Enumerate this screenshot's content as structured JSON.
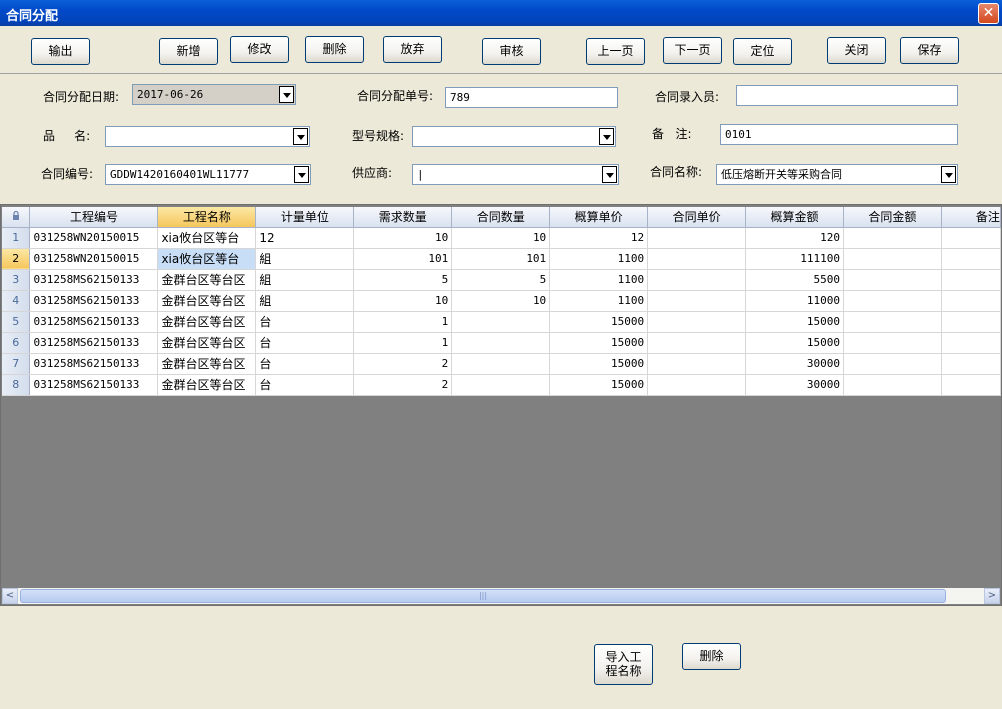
{
  "window": {
    "title": "合同分配",
    "close": "✕"
  },
  "toolbar": {
    "export": "输出",
    "add": "新增",
    "edit": "修改",
    "delete": "删除",
    "discard": "放弃",
    "audit": "审核",
    "prev": "上一页",
    "next": "下一页",
    "locate": "定位",
    "close": "关闭",
    "save": "保存"
  },
  "form": {
    "date_label": "合同分配日期:",
    "date_value": "2017-06-26",
    "no_label": "合同分配单号:",
    "no_value": "789",
    "entry_label": "合同录入员:",
    "entry_value": "",
    "product_label": "品     名:",
    "product_value": "",
    "model_label": "型号规格:",
    "model_value": "",
    "remark_label": "备   注:",
    "remark_value": "0101",
    "code_label": "合同编号:",
    "code_value": "GDDW1420160401WL11777",
    "supplier_label": "供应商:",
    "supplier_value": "|",
    "name_label": "合同名称:",
    "name_value": "低压熔断开关等采购合同"
  },
  "grid": {
    "columns": [
      "工程编号",
      "工程名称",
      "计量单位",
      "需求数量",
      "合同数量",
      "概算单价",
      "合同单价",
      "概算金额",
      "合同金额",
      "备注"
    ],
    "rows": [
      {
        "n": "1",
        "code": "031258WN20150015",
        "name": "xia攸台区等台",
        "unit": "12",
        "req": "10",
        "qty": "10",
        "est_price": "12",
        "price": "",
        "est_amount": "120",
        "amount": ""
      },
      {
        "n": "2",
        "code": "031258WN20150015",
        "name": "xia攸台区等台",
        "unit": "組",
        "req": "101",
        "qty": "101",
        "est_price": "1100",
        "price": "",
        "est_amount": "111100",
        "amount": ""
      },
      {
        "n": "3",
        "code": "031258MS62150133",
        "name": "金群台区等台区",
        "unit": "組",
        "req": "5",
        "qty": "5",
        "est_price": "1100",
        "price": "",
        "est_amount": "5500",
        "amount": ""
      },
      {
        "n": "4",
        "code": "031258MS62150133",
        "name": "金群台区等台区",
        "unit": "組",
        "req": "10",
        "qty": "10",
        "est_price": "1100",
        "price": "",
        "est_amount": "11000",
        "amount": ""
      },
      {
        "n": "5",
        "code": "031258MS62150133",
        "name": "金群台区等台区",
        "unit": "台",
        "req": "1",
        "qty": "",
        "est_price": "15000",
        "price": "",
        "est_amount": "15000",
        "amount": ""
      },
      {
        "n": "6",
        "code": "031258MS62150133",
        "name": "金群台区等台区",
        "unit": "台",
        "req": "1",
        "qty": "",
        "est_price": "15000",
        "price": "",
        "est_amount": "15000",
        "amount": ""
      },
      {
        "n": "7",
        "code": "031258MS62150133",
        "name": "金群台区等台区",
        "unit": "台",
        "req": "2",
        "qty": "",
        "est_price": "15000",
        "price": "",
        "est_amount": "30000",
        "amount": ""
      },
      {
        "n": "8",
        "code": "031258MS62150133",
        "name": "金群台区等台区",
        "unit": "台",
        "req": "2",
        "qty": "",
        "est_price": "15000",
        "price": "",
        "est_amount": "30000",
        "amount": ""
      }
    ],
    "scroll_left": "<",
    "scroll_right": ">",
    "scroll_grip": "|||"
  },
  "bottom": {
    "import_line1": "导入工",
    "import_line2": "程名称",
    "delete": "删除"
  },
  "colors": {
    "title_bar": "#0149C9",
    "selected_header": "#F6C65C",
    "grid_empty": "#808080"
  },
  "icons": {
    "lock": "lock-icon",
    "close": "close-icon"
  }
}
